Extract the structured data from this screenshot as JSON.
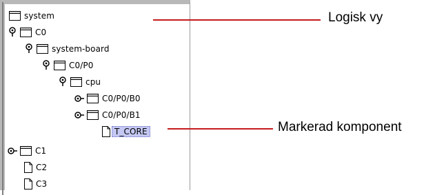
{
  "tree": {
    "nodes": [
      {
        "label": "system",
        "icon": "folder-icon",
        "toggle": "none"
      },
      {
        "label": "C0",
        "icon": "folder-icon",
        "toggle": "expanded"
      },
      {
        "label": "system-board",
        "icon": "folder-icon",
        "toggle": "expanded"
      },
      {
        "label": "C0/P0",
        "icon": "folder-icon",
        "toggle": "expanded"
      },
      {
        "label": "cpu",
        "icon": "folder-icon",
        "toggle": "expanded"
      },
      {
        "label": "C0/P0/B0",
        "icon": "folder-icon",
        "toggle": "collapsed"
      },
      {
        "label": "C0/P0/B1",
        "icon": "folder-icon",
        "toggle": "collapsed"
      },
      {
        "label": "T_CORE",
        "icon": "file-icon",
        "toggle": "none",
        "selected": true
      },
      {
        "label": "C1",
        "icon": "folder-icon",
        "toggle": "collapsed"
      },
      {
        "label": "C2",
        "icon": "file-icon",
        "toggle": "none"
      },
      {
        "label": "C3",
        "icon": "file-icon",
        "toggle": "none"
      }
    ]
  },
  "callouts": {
    "logical_view": "Logisk vy",
    "selected_component": "Markerad komponent"
  },
  "colors": {
    "callout_line": "#c41a1a",
    "selection_fill": "#c4c8f2",
    "panel_border": "#b8b8b8"
  }
}
